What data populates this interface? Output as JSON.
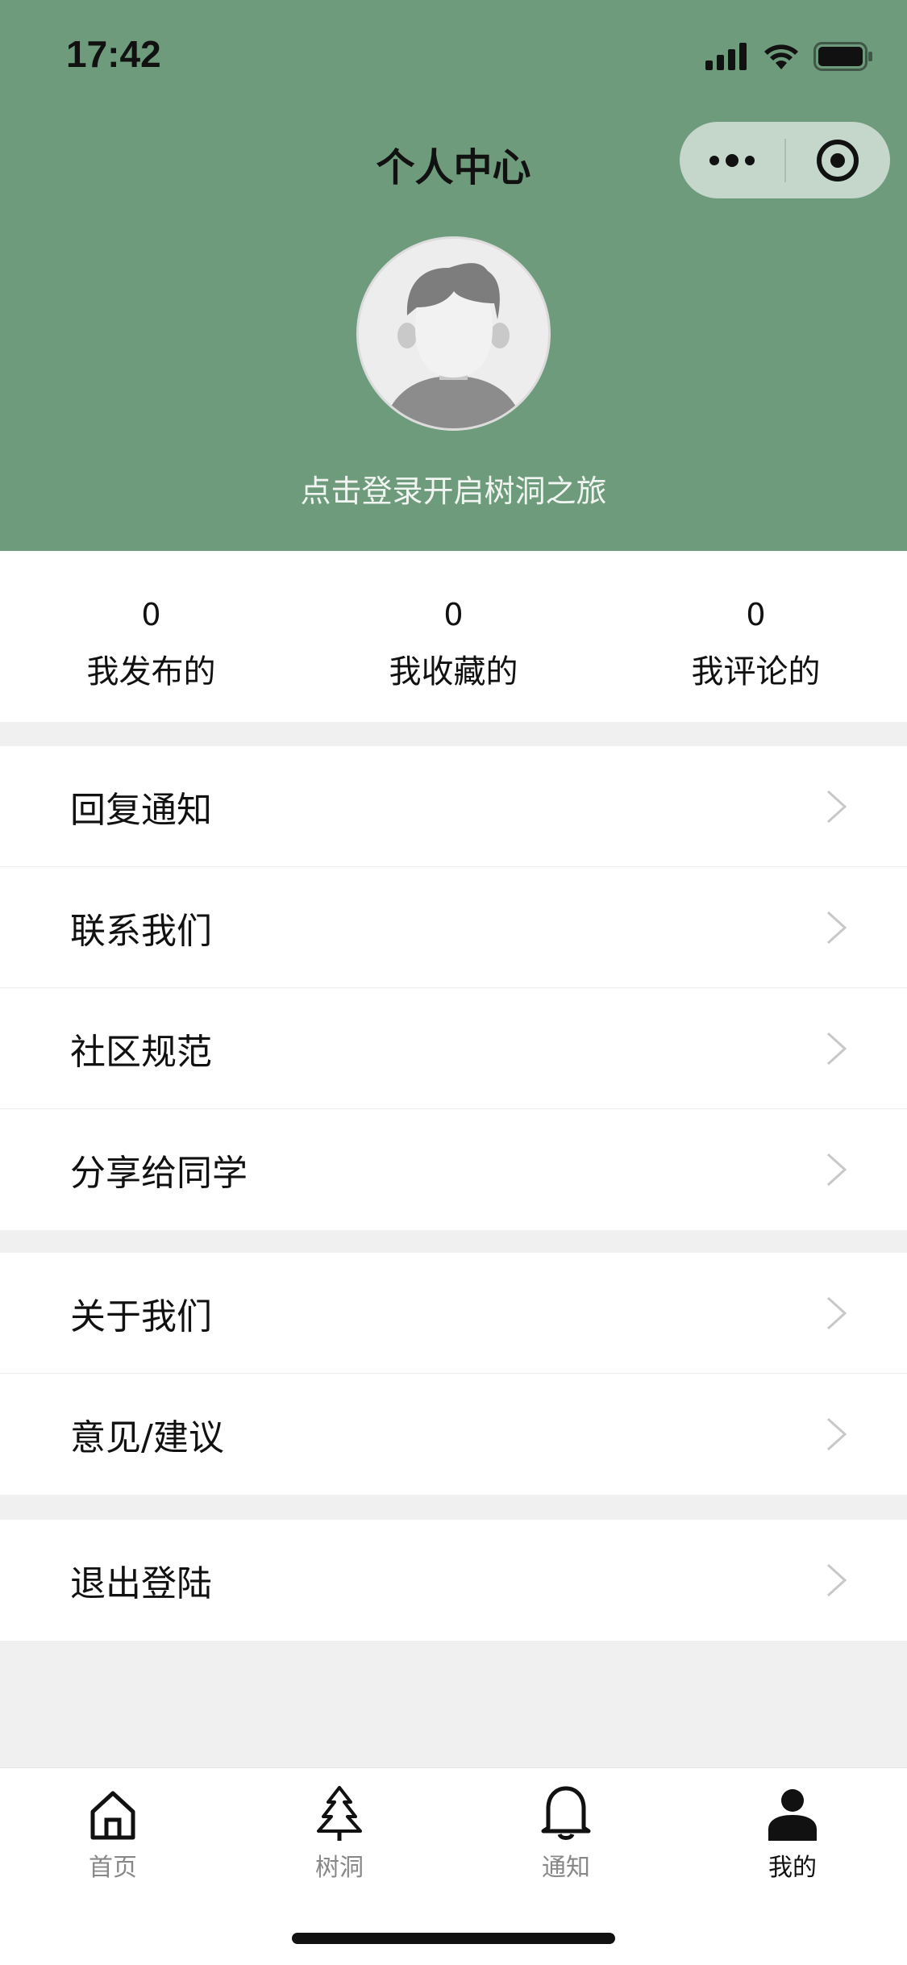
{
  "status_bar": {
    "time": "17:42"
  },
  "header": {
    "title": "个人中心",
    "login_tip": "点击登录开启树洞之旅",
    "background_color": "#6f9b7d"
  },
  "stats": [
    {
      "value": "0",
      "label": "我发布的"
    },
    {
      "value": "0",
      "label": "我收藏的"
    },
    {
      "value": "0",
      "label": "我评论的"
    }
  ],
  "menu_groups": [
    {
      "items": [
        "回复通知",
        "联系我们",
        "社区规范",
        "分享给同学"
      ]
    },
    {
      "items": [
        "关于我们",
        "意见/建议"
      ]
    },
    {
      "items": [
        "退出登陆"
      ]
    }
  ],
  "tabbar": {
    "tabs": [
      {
        "label": "首页",
        "icon": "home-icon",
        "active": false
      },
      {
        "label": "树洞",
        "icon": "tree-icon",
        "active": false
      },
      {
        "label": "通知",
        "icon": "bell-icon",
        "active": false
      },
      {
        "label": "我的",
        "icon": "person-icon",
        "active": true
      }
    ]
  }
}
